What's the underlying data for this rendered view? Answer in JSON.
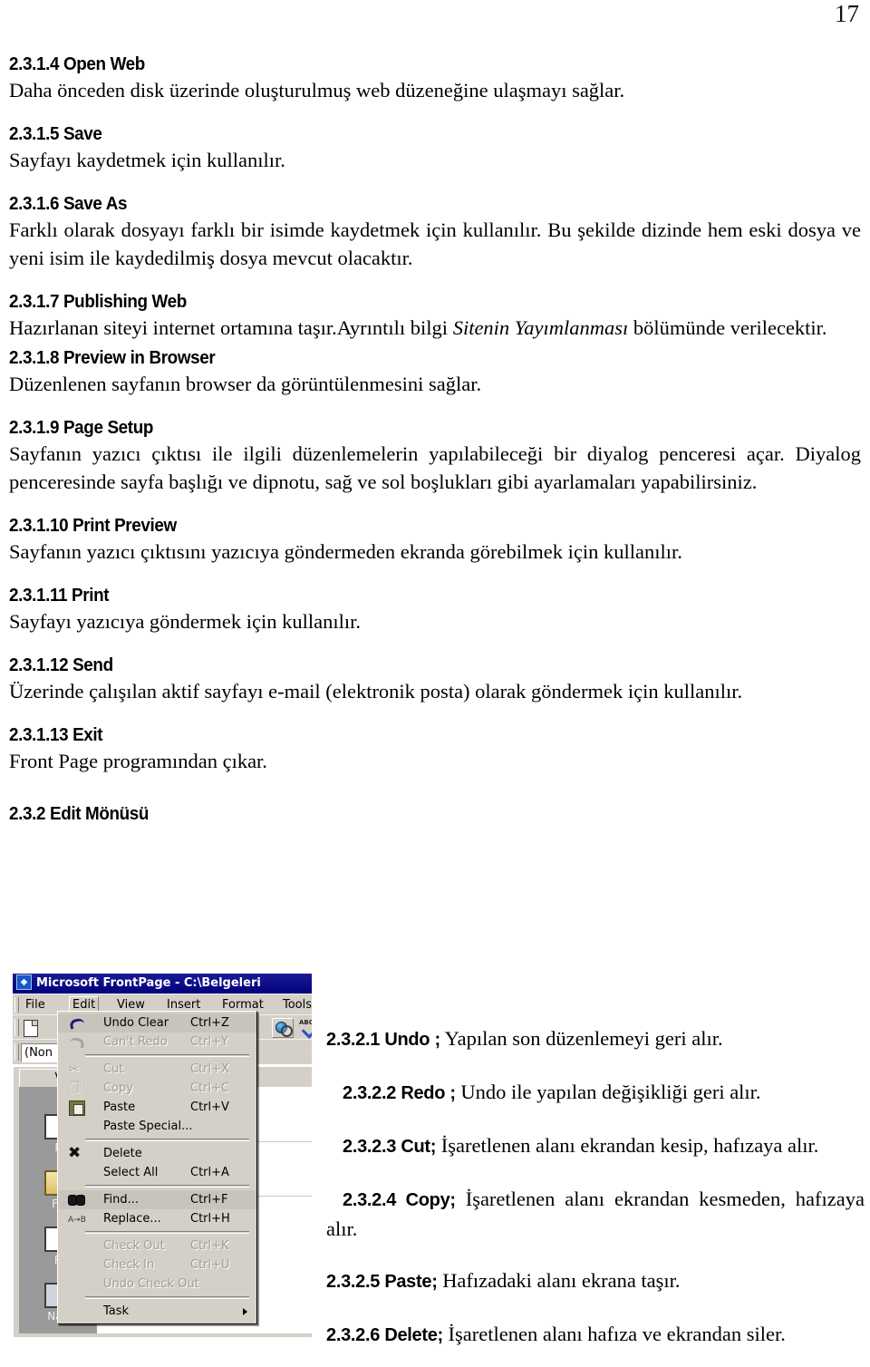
{
  "page": {
    "number": "17"
  },
  "sections": [
    {
      "id": "2.3.1.4",
      "heading": "2.3.1.4 Open Web",
      "body": "Daha önceden disk üzerinde oluşturulmuş web düzeneğine ulaşmayı sağlar."
    },
    {
      "id": "2.3.1.5",
      "heading": "2.3.1.5  Save",
      "body": "Sayfayı kaydetmek için kullanılır."
    },
    {
      "id": "2.3.1.6",
      "heading": "2.3.1.6  Save As",
      "body": "Farklı olarak dosyayı farklı bir isimde kaydetmek için kullanılır. Bu şekilde dizinde hem eski dosya ve yeni isim ile kaydedilmiş dosya mevcut olacaktır."
    },
    {
      "id": "2.3.1.7",
      "heading": "2.3.1.7  Publishing Web",
      "body_part1": "Hazırlanan siteyi internet ortamına taşır.Ayrıntılı bilgi ",
      "body_italic": "Sitenin Yayımlanması",
      "body_part2": " bölümünde verilecektir."
    },
    {
      "id": "2.3.1.8",
      "heading": "2.3.1.8  Preview in Browser",
      "body": "Düzenlenen sayfanın browser da görüntülenmesini sağlar."
    },
    {
      "id": "2.3.1.9",
      "heading": "2.3.1.9  Page Setup",
      "body": "Sayfanın yazıcı çıktısı ile ilgili düzenlemelerin yapılabileceği bir diyalog penceresi açar. Diyalog penceresinde sayfa başlığı ve dipnotu, sağ ve sol boşlukları gibi ayarlamaları yapabilirsiniz."
    },
    {
      "id": "2.3.1.10",
      "heading": "2.3.1.10  Print Preview",
      "body": "Sayfanın yazıcı çıktısını yazıcıya göndermeden ekranda görebilmek için kullanılır."
    },
    {
      "id": "2.3.1.11",
      "heading": "2.3.1.11 Print",
      "body": "Sayfayı yazıcıya göndermek için kullanılır."
    },
    {
      "id": "2.3.1.12",
      "heading": "2.3.1.12 Send",
      "body": "Üzerinde çalışılan aktif sayfayı e-mail  (elektronik posta) olarak göndermek için kullanılır."
    },
    {
      "id": "2.3.1.13",
      "heading": "2.3.1.13 Exit",
      "body": "Front Page programından çıkar."
    }
  ],
  "edit_menu_heading": "2.3.2 Edit Mönüsü",
  "figure": {
    "title": "Microsoft FrontPage - C:\\Belgeleri",
    "title_icon": "frontpage-logo-icon",
    "menubar": [
      "File",
      "Edit",
      "View",
      "Insert",
      "Format",
      "Tools"
    ],
    "active_menu": "Edit",
    "style_combo_value": "(Non",
    "views_tab_label": "V",
    "views_items": [
      {
        "label": "P",
        "icon": "page-view-icon"
      },
      {
        "label": "Fo",
        "icon": "folders-view-icon"
      },
      {
        "label": "R",
        "icon": "reports-view-icon"
      },
      {
        "label": "Nav",
        "icon": "navigation-view-icon"
      }
    ],
    "toolbar_buttons": [
      {
        "name": "new-page-button",
        "icon": "new-document-icon"
      },
      {
        "name": "preview-in-browser-button",
        "icon": "globe-magnifier-icon"
      },
      {
        "name": "spelling-button",
        "icon": "abc-check-icon"
      }
    ],
    "menu_items": [
      {
        "label": "Undo Clear",
        "accel": "Ctrl+Z",
        "icon": "undo-icon",
        "disabled": false,
        "highlight": true,
        "sep_after": false
      },
      {
        "label": "Can't Redo",
        "accel": "Ctrl+Y",
        "icon": "redo-icon",
        "disabled": true,
        "highlight": false,
        "sep_after": true
      },
      {
        "label": "Cut",
        "accel": "Ctrl+X",
        "icon": "scissors-icon",
        "disabled": true,
        "highlight": false,
        "sep_after": false
      },
      {
        "label": "Copy",
        "accel": "Ctrl+C",
        "icon": "copy-icon",
        "disabled": true,
        "highlight": false,
        "sep_after": false
      },
      {
        "label": "Paste",
        "accel": "Ctrl+V",
        "icon": "paste-icon",
        "disabled": false,
        "highlight": false,
        "sep_after": false
      },
      {
        "label": "Paste Special...",
        "accel": "",
        "icon": "",
        "disabled": false,
        "highlight": false,
        "sep_after": true
      },
      {
        "label": "Delete",
        "accel": "",
        "icon": "delete-x-icon",
        "disabled": false,
        "highlight": false,
        "sep_after": false
      },
      {
        "label": "Select All",
        "accel": "Ctrl+A",
        "icon": "",
        "disabled": false,
        "highlight": false,
        "sep_after": true
      },
      {
        "label": "Find...",
        "accel": "Ctrl+F",
        "icon": "binoculars-icon",
        "disabled": false,
        "highlight": true,
        "sep_after": false
      },
      {
        "label": "Replace...",
        "accel": "Ctrl+H",
        "icon": "replace-icon",
        "disabled": false,
        "highlight": false,
        "sep_after": true
      },
      {
        "label": "Check Out",
        "accel": "Ctrl+K",
        "icon": "",
        "disabled": true,
        "highlight": false,
        "sep_after": false
      },
      {
        "label": "Check In",
        "accel": "Ctrl+U",
        "icon": "",
        "disabled": true,
        "highlight": false,
        "sep_after": false
      },
      {
        "label": "Undo Check Out",
        "accel": "",
        "icon": "",
        "disabled": true,
        "highlight": false,
        "sep_after": true
      },
      {
        "label": "Task",
        "accel": "",
        "icon": "",
        "disabled": false,
        "highlight": false,
        "sep_after": false,
        "submenu": true
      }
    ]
  },
  "edit_items": [
    {
      "lead": "2.3.2.1 Undo ;",
      "text": " Yapılan son düzenlemeyi geri alır."
    },
    {
      "lead": "2.3.2.2  Redo ;",
      "text": " Undo ile yapılan değişikliği geri alır."
    },
    {
      "lead": "2.3.2.3    Cut;",
      "text": " İşaretlenen alanı ekrandan kesip, hafızaya alır."
    },
    {
      "lead": "2.3.2.4    Copy;",
      "text": " İşaretlenen alanı ekrandan kesmeden, hafızaya alır."
    },
    {
      "lead": "2.3.2.5 Paste;",
      "text": " Hafızadaki alanı ekrana taşır."
    },
    {
      "lead": "2.3.2.6  Delete;",
      "text": " İşaretlenen alanı hafıza ve ekrandan siler."
    }
  ]
}
